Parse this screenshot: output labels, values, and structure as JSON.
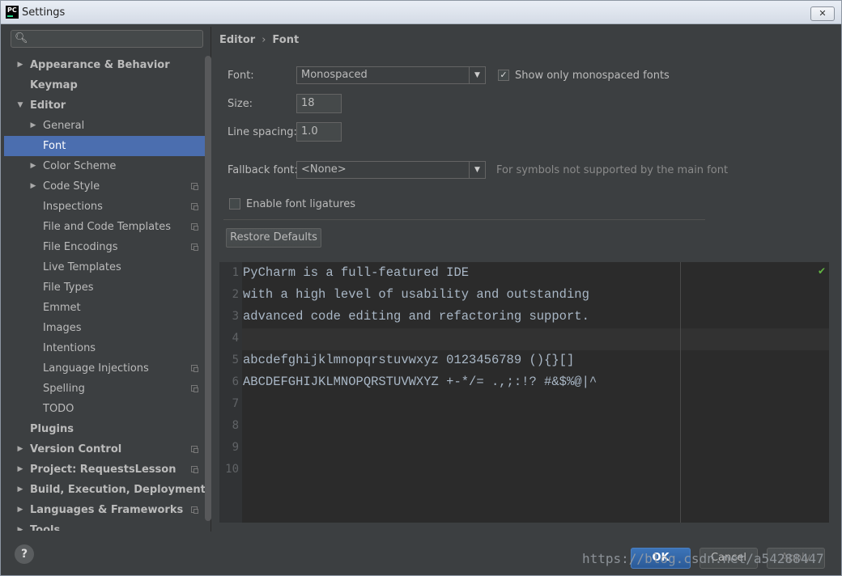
{
  "window": {
    "title": "Settings",
    "logo_text": "PC",
    "close_label": "✕"
  },
  "search": {
    "placeholder": ""
  },
  "sidebar": {
    "items": [
      {
        "label": "Appearance & Behavior",
        "level": 0,
        "bold": true,
        "arrow": "▶",
        "copy": false
      },
      {
        "label": "Keymap",
        "level": 0,
        "bold": true,
        "arrow": "",
        "copy": false
      },
      {
        "label": "Editor",
        "level": 0,
        "bold": true,
        "arrow": "▼",
        "copy": false
      },
      {
        "label": "General",
        "level": 1,
        "bold": false,
        "arrow": "▶",
        "copy": false
      },
      {
        "label": "Font",
        "level": 1,
        "bold": false,
        "arrow": "",
        "copy": false,
        "selected": true
      },
      {
        "label": "Color Scheme",
        "level": 1,
        "bold": false,
        "arrow": "▶",
        "copy": false
      },
      {
        "label": "Code Style",
        "level": 1,
        "bold": false,
        "arrow": "▶",
        "copy": true
      },
      {
        "label": "Inspections",
        "level": 1,
        "bold": false,
        "arrow": "",
        "copy": true
      },
      {
        "label": "File and Code Templates",
        "level": 1,
        "bold": false,
        "arrow": "",
        "copy": true
      },
      {
        "label": "File Encodings",
        "level": 1,
        "bold": false,
        "arrow": "",
        "copy": true
      },
      {
        "label": "Live Templates",
        "level": 1,
        "bold": false,
        "arrow": "",
        "copy": false
      },
      {
        "label": "File Types",
        "level": 1,
        "bold": false,
        "arrow": "",
        "copy": false
      },
      {
        "label": "Emmet",
        "level": 1,
        "bold": false,
        "arrow": "",
        "copy": false
      },
      {
        "label": "Images",
        "level": 1,
        "bold": false,
        "arrow": "",
        "copy": false
      },
      {
        "label": "Intentions",
        "level": 1,
        "bold": false,
        "arrow": "",
        "copy": false
      },
      {
        "label": "Language Injections",
        "level": 1,
        "bold": false,
        "arrow": "",
        "copy": true
      },
      {
        "label": "Spelling",
        "level": 1,
        "bold": false,
        "arrow": "",
        "copy": true
      },
      {
        "label": "TODO",
        "level": 1,
        "bold": false,
        "arrow": "",
        "copy": false
      },
      {
        "label": "Plugins",
        "level": 0,
        "bold": true,
        "arrow": "",
        "copy": false
      },
      {
        "label": "Version Control",
        "level": 0,
        "bold": true,
        "arrow": "▶",
        "copy": true
      },
      {
        "label": "Project: RequestsLesson",
        "level": 0,
        "bold": true,
        "arrow": "▶",
        "copy": true
      },
      {
        "label": "Build, Execution, Deployment",
        "level": 0,
        "bold": true,
        "arrow": "▶",
        "copy": false
      },
      {
        "label": "Languages & Frameworks",
        "level": 0,
        "bold": true,
        "arrow": "▶",
        "copy": true
      },
      {
        "label": "Tools",
        "level": 0,
        "bold": true,
        "arrow": "▶",
        "copy": false
      }
    ]
  },
  "breadcrumb": {
    "part1": "Editor",
    "sep": "›",
    "part2": "Font"
  },
  "form": {
    "font_label": "Font:",
    "font_value": "Monospaced",
    "show_mono_checked": "✓",
    "show_mono_label": "Show only monospaced fonts",
    "size_label": "Size:",
    "size_value": "18",
    "line_spacing_label": "Line spacing:",
    "line_spacing_value": "1.0",
    "fallback_label": "Fallback font:",
    "fallback_value": "<None>",
    "fallback_hint": "For symbols not supported by the main font",
    "ligatures_label": "Enable font ligatures",
    "restore_label": "Restore Defaults"
  },
  "preview": {
    "lines": [
      {
        "num": "1",
        "text": "PyCharm is a full-featured IDE"
      },
      {
        "num": "2",
        "text": "with a high level of usability and outstanding"
      },
      {
        "num": "3",
        "text": "advanced code editing and refactoring support."
      },
      {
        "num": "4",
        "text": ""
      },
      {
        "num": "5",
        "text": "abcdefghijklmnopqrstuvwxyz 0123456789 (){}[]"
      },
      {
        "num": "6",
        "text": "ABCDEFGHIJKLMNOPQRSTUVWXYZ +-*/= .,;:!? #&$%@|^"
      },
      {
        "num": "7",
        "text": ""
      },
      {
        "num": "8",
        "text": ""
      },
      {
        "num": "9",
        "text": ""
      },
      {
        "num": "10",
        "text": ""
      }
    ],
    "status_mark": "✔"
  },
  "buttons": {
    "help": "?",
    "ok": "OK",
    "cancel": "Cancel",
    "apply": "Apply"
  },
  "watermark": "https://blog.csdn.net/a54288447",
  "colors": {
    "selection": "#4b6eaf",
    "background": "#3c3f41",
    "editor_bg": "#2b2b2b",
    "code_text": "#a9b7c6"
  }
}
